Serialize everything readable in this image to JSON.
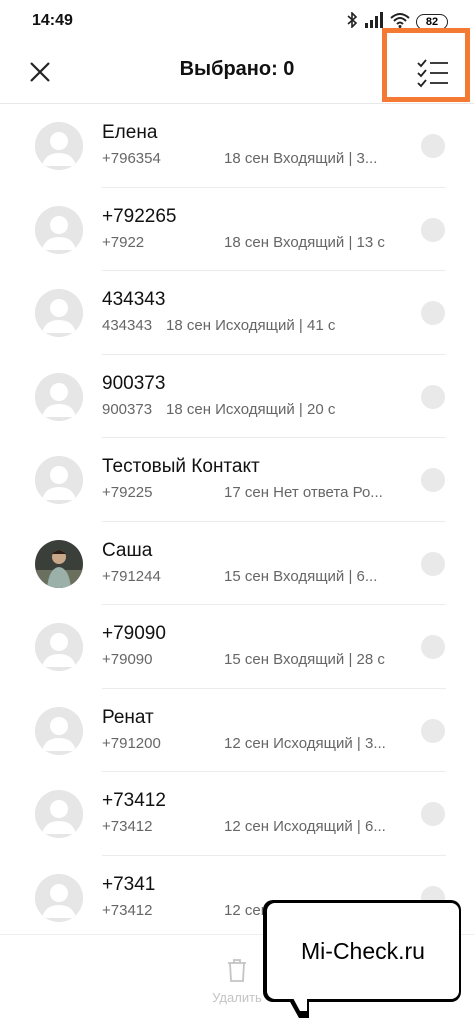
{
  "status_bar": {
    "time": "14:49",
    "battery": "82",
    "icons": [
      "bluetooth-icon",
      "signal-icon",
      "wifi-icon",
      "battery-icon"
    ]
  },
  "header": {
    "title": "Выбрано: 0",
    "close_icon": "close-icon",
    "select_all_icon": "checklist-icon",
    "highlight_color": "#f47a33"
  },
  "calls": [
    {
      "name": "Елена",
      "number": "+796354",
      "details": "18 сен Входящий | 3...",
      "avatar": "default"
    },
    {
      "name": "+792265",
      "number": "+7922",
      "details": "18 сен Входящий | 13 с",
      "avatar": "default"
    },
    {
      "name": "434343",
      "number": "434343",
      "details": "18 сен Исходящий | 41 с",
      "avatar": "default"
    },
    {
      "name": "900373",
      "number": "900373",
      "details": "18 сен Исходящий | 20 с",
      "avatar": "default"
    },
    {
      "name": "Тестовый Контакт",
      "number": "+79225",
      "details": "17 сен Нет ответа Ро...",
      "avatar": "default"
    },
    {
      "name": "Саша",
      "number": "+791244",
      "details": "15 сен Входящий | 6...",
      "avatar": "photo"
    },
    {
      "name": "+79090",
      "number": "+79090",
      "details": "15 сен Входящий | 28 с",
      "avatar": "default"
    },
    {
      "name": "Ренат",
      "number": "+791200",
      "details": "12 сен Исходящий | 3...",
      "avatar": "default"
    },
    {
      "name": "+73412",
      "number": "+73412",
      "details": "12 сен Исходящий | 6...",
      "avatar": "default"
    },
    {
      "name": "+7341",
      "number": "+73412",
      "details": "12 сен Исходящий | 6...",
      "avatar": "default"
    }
  ],
  "bottom_bar": {
    "delete_label": "Удалить",
    "delete_icon": "trash-icon"
  },
  "watermark": {
    "text": "Mi-Check.ru"
  }
}
